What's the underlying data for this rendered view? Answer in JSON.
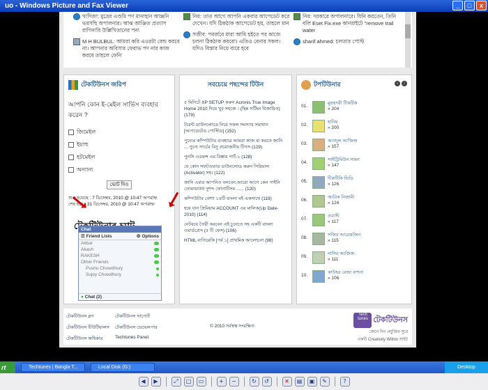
{
  "window": {
    "title": "uo - Windows Picture and Fax Viewer",
    "controls": [
      "_",
      "□",
      "x"
    ]
  },
  "top_comments": [
    {
      "text": "খাদিজা: মুদ্রের এণ্ডমি পণ মানাহান আঞ্জনি ভরসছি অপালনার। আঝ আঞ্জিত প্রত্যাস রাগিনারি উল্লিখিতানের পন্য"
    },
    {
      "text": "নিয়: তাত আগে আপনি একবার আপেডেট করে দেখেন। যদি ঠিকঠাক আপেডেট হয়, তাহলে মান"
    },
    {
      "text": "নিয়: দরকারে অপালনারে। যিনি করতেন, তিনি বলি Eset Fix.exe কানরাইটে \"remove trail water"
    },
    {
      "text": "M H BULBUL: আমরা করি এওরটা বেন্ড করবে না। আপনার অবিসার ফেরাভ পদ নার কাজ করবে তাহলে ফেনি"
    },
    {
      "text": "সজীব: পবর্জবে মারা আমি হইতে পর কাজে চলনা ঠিকঠাক করবো। এতিও বেনার সকল। যদিও বিস্তার নিয়ে ব্যরে হবে"
    },
    {
      "text": "sharif ahmed: চলতার পোস্ট"
    }
  ],
  "survey": {
    "title": "টেকটিউনস জরিপ",
    "question": "আপনি কোন ই-মেইল সার্ভিস ব্যবহার করেন ?",
    "options": [
      "জিমেইল",
      "ইয়াহু",
      "হটমেইল",
      "অন্যান্য"
    ],
    "vote_label": "ভোট দিও",
    "start_text": "শুরু হয়েছে : 7 ডিসেম্বর, 2010 @ 10:47 অপরাহ্ন",
    "end_text": "শেষ হবে : 31 ডিসেম্বর, 2010 @ 10:47 অপরাহ্ন"
  },
  "annotation": {
    "text": "টেকটিউনার চ্যাট"
  },
  "chat": {
    "header": "Chat",
    "tab_friends": "Friend Lists",
    "tab_options": "Options",
    "friends": [
      {
        "name": "Akbar",
        "status": "toggle"
      },
      {
        "name": "Akash",
        "status": "toggle"
      },
      {
        "name": "RAKESH",
        "status": "toggle"
      },
      {
        "name": "Other Friends",
        "status": "toggle"
      },
      {
        "name": "Pushu Chowdhury",
        "status": "dot"
      },
      {
        "name": "Sujoy Chowdhury",
        "status": "dot"
      }
    ],
    "footer": "Chat (2)"
  },
  "popular": {
    "title": "সবচেয়ে পছন্দের টিউন",
    "items": [
      "৫ মিনিটে XP SETUP করুন Acronis True Image Home 2010 দিয়ে খুব সহজে । (ছিন্ন সর্টিমং বিজারিত) (179)",
      "টরেন্ট ডাউনলোডে নিয়ে সকল সমস্যার সমাধান [আপডেটেড পোস্টিড] (152)",
      "পুন্যের কম্পিউটার ব্যবহারে আমরা কাজ বা করতে জানি ... পুন্যে সার্চের বিনু প্রয়োজনীয় টিপস (129)",
      "পুনসি এডমন্স এর বিস্তার পার্ট-২ (128)",
      "যে কোন সফটওয়্যার ডাউনলোড করুন সিরিয়াল (Activator) সহ। (122)",
      "জানি এবার আপনিও বলবেন,আরো আগে কেন পাইনি তোমায়!!!!!! দুশব্দ ফোনাটিসম ...... (120)",
      "কম্পিউটার বেশ্যা ১৪টি বাংলা বই একসাথে (119)",
      "হয়ে যান প্রিমিয়াম ACCOUNT এর মালিক(Up Date-2010) (114)",
      "নেটবয়ে তৈরী করবেন এই চুনেতে সহ একটি বাংলা ওয়ার্ডপ্রেস (৫ টি ফেস) (106)",
      "HTML ব্যতিরেকি [পর্ব ১] প্রাথমিক আলোচনা (98)"
    ]
  },
  "top_users": {
    "title": "টপটিউনার",
    "nav_prev": "‹",
    "nav_next": "›",
    "users": [
      {
        "rank": "01.",
        "name": "মুহম্মদরী টিকটিক",
        "score": "» 204",
        "color": "#8cc070"
      },
      {
        "rank": "02.",
        "name": "হানিম",
        "score": "» 200",
        "color": "#e8e070"
      },
      {
        "rank": "03.",
        "name": "আবদুল আজিজ",
        "score": "» 157",
        "color": "#d8b080"
      },
      {
        "rank": "04.",
        "name": "সাইট্রিমিউন সামন",
        "score": "» 147",
        "color": "#a0d070"
      },
      {
        "rank": "05.",
        "name": "টিকটিকি ভিডি",
        "score": "» 126",
        "color": "#90a8c0"
      },
      {
        "rank": "06.",
        "name": "আরিক নিজামী",
        "score": "» 124",
        "color": "#b0c890"
      },
      {
        "rank": "07.",
        "name": "প্রবাসী",
        "score": "» 117",
        "color": "#98c878"
      },
      {
        "rank": "08.",
        "name": "সজিব আরেকজিন",
        "score": "» 115",
        "color": "#a8b8a0"
      },
      {
        "rank": "09.",
        "name": "নাসির আজিজ",
        "score": "» 111",
        "color": "#c0d0b0"
      },
      {
        "rank": "10.",
        "name": "কাউহর রেজা বাশনা",
        "score": "» 106",
        "color": "#7fa8d0"
      }
    ]
  },
  "footer": {
    "links": [
      "টেকটিউনস ব্লগ",
      "টেকটিউনস সাপোর্ট",
      "টেকটিউনস টিউটিয়ালস",
      "টেকটিউনস ডেভেলপার",
      "টেকটিউনস অধিকার",
      "Techtunes Panel"
    ],
    "copyright": "© 2010 সর্বস্বত্ব সংরক্ষিত",
    "brand_logo": "Tech tunes",
    "brand_name": "টেকটিউনস",
    "brand_tag1": "জেনে দিন প্রযুক্তির সুরে",
    "brand_tag2": "একটি Creativity Within সাইট"
  },
  "taskbar": {
    "start": "rt",
    "buttons": [
      "Techtunes | Bangla T...",
      "Local Disk (G:)"
    ],
    "tray": "Desktop"
  },
  "toolbar_icons": [
    "prev-icon",
    "next-icon",
    "best-fit-icon",
    "actual-size-icon",
    "slideshow-icon",
    "zoom-in-icon",
    "zoom-out-icon",
    "rotate-cw-icon",
    "rotate-ccw-icon",
    "delete-icon",
    "print-icon",
    "save-icon",
    "edit-icon",
    "help-icon"
  ]
}
